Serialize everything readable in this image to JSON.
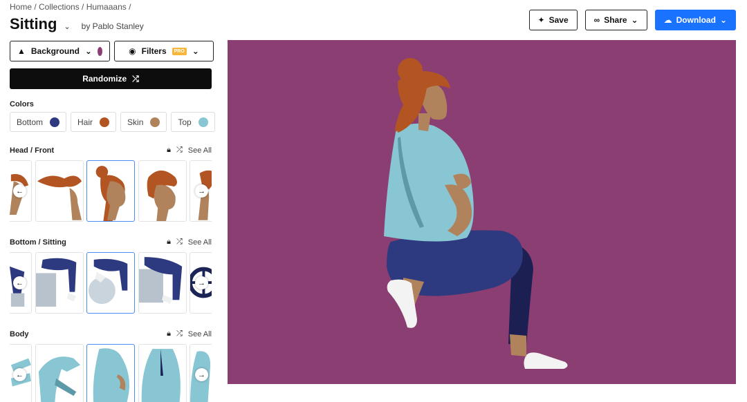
{
  "breadcrumb": "Home / Collections / Humaaans /",
  "header": {
    "title": "Sitting",
    "author": "by Pablo Stanley",
    "save_label": "Save",
    "share_label": "Share",
    "download_label": "Download"
  },
  "controls": {
    "background_label": "Background",
    "background_color": "#8b3e72",
    "filters_label": "Filters",
    "pro_badge": "PRO",
    "randomize_label": "Randomize"
  },
  "colors": {
    "label": "Colors",
    "items": [
      {
        "label": "Bottom",
        "color": "#2e3a80"
      },
      {
        "label": "Hair",
        "color": "#b35522"
      },
      {
        "label": "Skin",
        "color": "#b0835d"
      },
      {
        "label": "Top",
        "color": "#88c6d3"
      }
    ]
  },
  "sections": [
    {
      "title": "Head / Front",
      "see_all": "See All"
    },
    {
      "title": "Bottom / Sitting",
      "see_all": "See All"
    },
    {
      "title": "Body",
      "see_all": "See All"
    }
  ],
  "icons": {
    "save": "pin-icon",
    "share": "link-icon",
    "download": "cloud-download-icon",
    "background": "paint-bucket-icon",
    "filters": "palette-icon",
    "randomize": "shuffle-icon",
    "lock": "lock-icon",
    "prev": "arrow-left-icon",
    "next": "arrow-right-icon"
  }
}
